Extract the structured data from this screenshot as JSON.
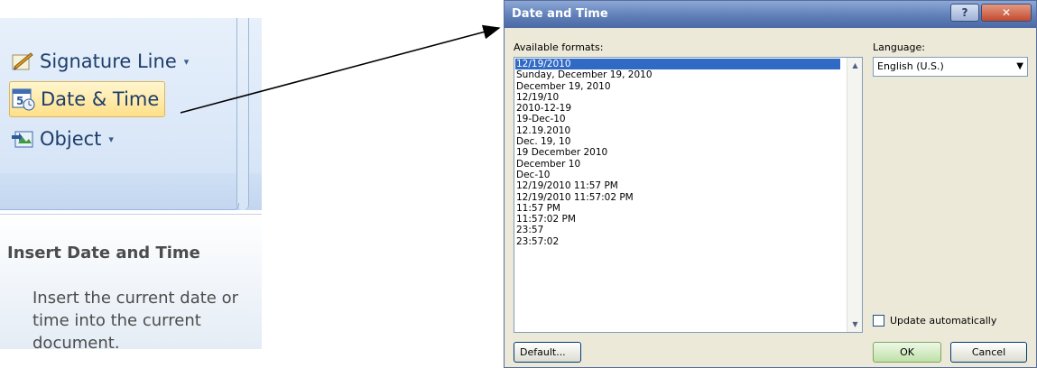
{
  "ribbon": {
    "signature_line": "Signature Line",
    "date_time": "Date & Time",
    "object": "Object",
    "caret": "▾"
  },
  "tooltip": {
    "title": "Insert Date and Time",
    "body": "Insert the current date or time into the current document."
  },
  "dialog": {
    "title": "Date and Time",
    "help_glyph": "?",
    "close_glyph": "✕",
    "available_formats_label": "Available formats:",
    "formats": [
      "12/19/2010",
      "Sunday, December 19, 2010",
      "December 19, 2010",
      "12/19/10",
      "2010-12-19",
      "19-Dec-10",
      "12.19.2010",
      "Dec. 19, 10",
      "19 December 2010",
      "December 10",
      "Dec-10",
      "12/19/2010 11:57 PM",
      "12/19/2010 11:57:02 PM",
      "11:57 PM",
      "11:57:02 PM",
      "23:57",
      "23:57:02"
    ],
    "selected_index": 0,
    "language_label": "Language:",
    "language_value": "English (U.S.)",
    "update_label": "Update automatically",
    "default_button": "Default...",
    "ok_button": "OK",
    "cancel_button": "Cancel"
  },
  "colors": {
    "selection": "#316ac5",
    "titlebar": "#5f7fb8",
    "ribbon_text": "#1d3e6b"
  }
}
